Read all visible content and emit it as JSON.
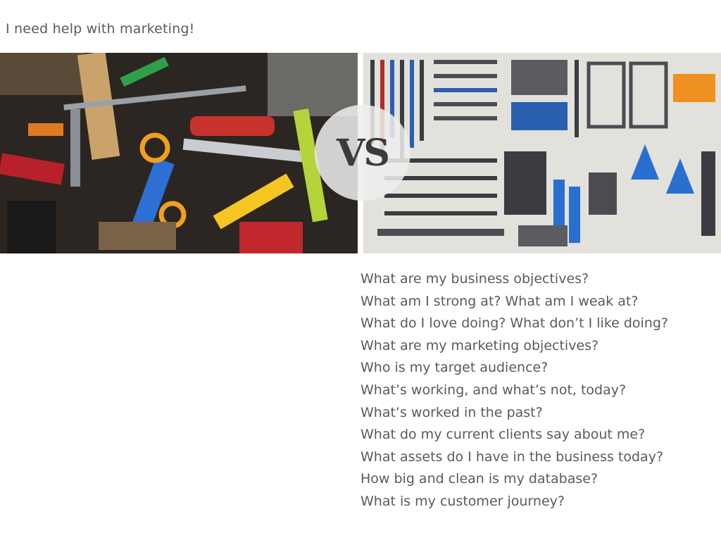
{
  "headline": "I need help with marketing!",
  "images": {
    "left": {
      "subject": "messy-pile-of-tools"
    },
    "right": {
      "subject": "organized-tool-wall"
    }
  },
  "badge": {
    "label": "VS"
  },
  "questions": [
    "What are my business objectives?",
    "What am I strong at? What am I weak at?",
    "What do I love doing? What don’t I like doing?",
    "What are my marketing objectives?",
    "Who is my target audience?",
    "What’s working, and what’s not, today?",
    "What’s worked in the past?",
    "What do my current clients say about me?",
    "What assets do I have in the business today?",
    "How big and clean is my database?",
    "What is my customer journey?"
  ],
  "colors": {
    "text": "#5a5a5a",
    "badge_bg": "#eeeeec",
    "badge_text": "#3b3b3b"
  }
}
